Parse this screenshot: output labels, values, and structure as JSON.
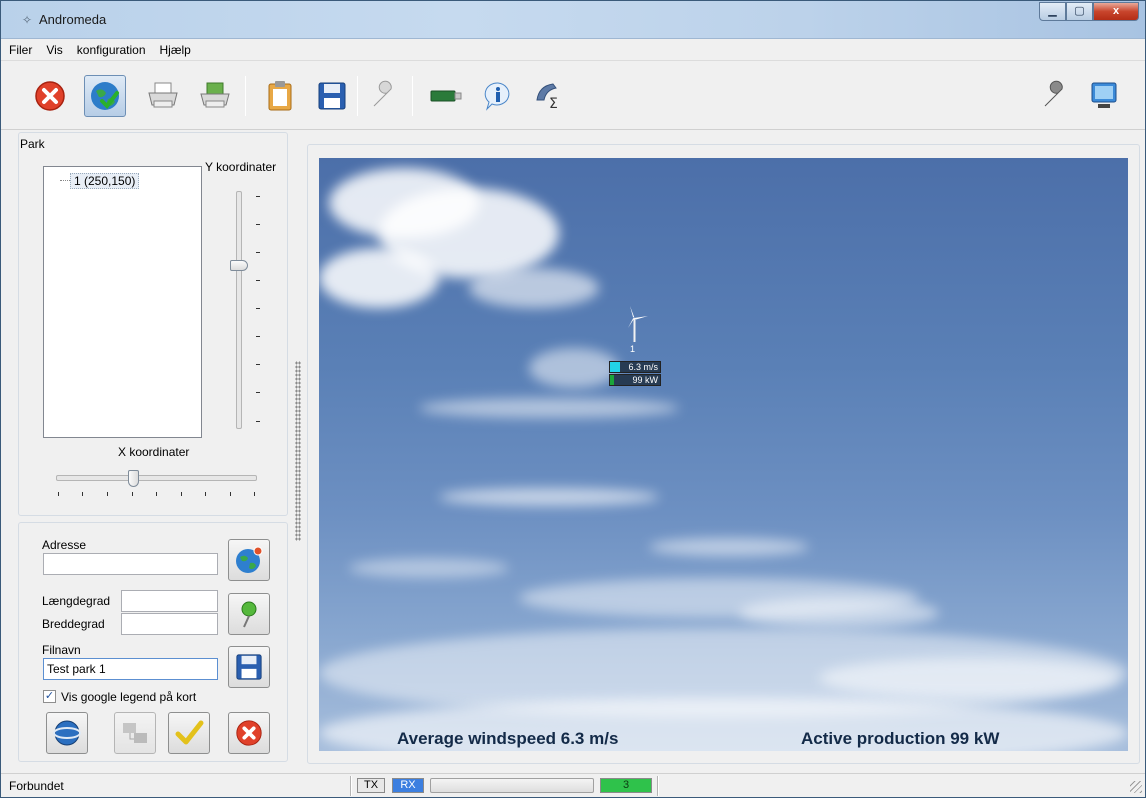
{
  "window": {
    "title": "Andromeda",
    "controls": [
      "minimize",
      "maximize",
      "close"
    ],
    "close_glyph": "x"
  },
  "menu": [
    "Filer",
    "Vis",
    "konfiguration",
    "Hjælp"
  ],
  "toolbar": {
    "buttons": [
      "close-red-icon",
      "globe-check-icon",
      "printer-icon",
      "print-preview-icon",
      "clipboard-icon",
      "floppy-disk-icon",
      "wrench-icon",
      "usb-stick-icon",
      "info-icon",
      "phone-sigma-icon",
      "settings-wrench-icon",
      "monitor-icon"
    ],
    "active": "globe-check-icon"
  },
  "park": {
    "label": "Park",
    "items": [
      "1 (250,150)"
    ],
    "y_label": "Y koordinater",
    "x_label": "X koordinater",
    "y_slider_fraction": 0.26,
    "x_slider_fraction": 0.38
  },
  "form": {
    "address_label": "Adresse",
    "address_value": "",
    "longitude_label": "Længdegrad",
    "longitude_value": "",
    "latitude_label": "Breddegrad",
    "latitude_value": "",
    "filename_label": "Filnavn",
    "filename_value": "Test park 1",
    "checkbox_label": "Vis google legend på kort",
    "checkbox_checked": true
  },
  "map": {
    "turbine_label": "1",
    "wind_speed_label": "6.3 m/s",
    "production_label": "99 kW",
    "avg_windspeed_text": "Average windspeed 6.3 m/s",
    "active_production_text": "Active production 99 kW",
    "colors": {
      "wind_fill": "#22d3e8",
      "production_fill": "#1aa53a"
    }
  },
  "status": {
    "text": "Forbundet",
    "tx": "TX",
    "rx": "RX",
    "count": "3",
    "colors": {
      "rx": "#3c7fe0",
      "count": "#2fc24b"
    }
  }
}
